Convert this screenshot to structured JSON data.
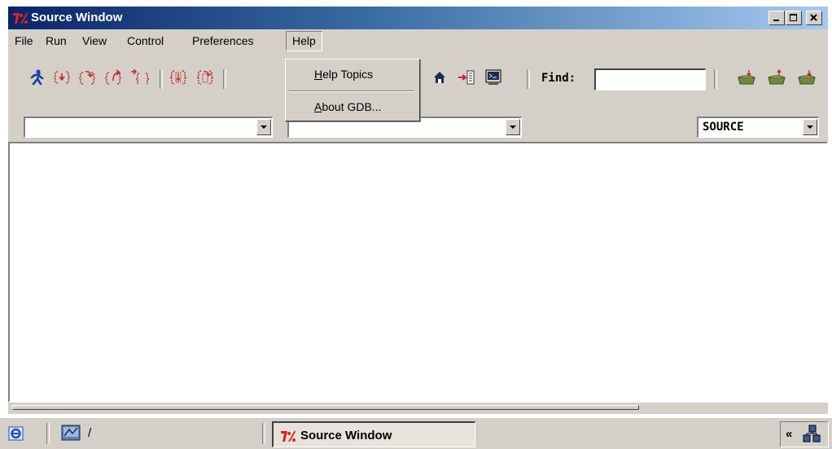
{
  "window": {
    "title": "Source Window",
    "minimize": "_",
    "maximize": "□",
    "close": "×"
  },
  "menubar": {
    "items": [
      "File",
      "Run",
      "View",
      "Control",
      "Preferences",
      "Help"
    ],
    "open_menu": "Help"
  },
  "help_menu": {
    "items": [
      {
        "mnemonic": "H",
        "rest": "elp Topics"
      },
      {
        "mnemonic": "A",
        "rest": "bout GDB..."
      }
    ]
  },
  "toolbar": {
    "find_label": "Find:",
    "find_value": "",
    "function_combo_value": "",
    "file_combo_value": "",
    "mode_combo_value": "SOURCE"
  },
  "taskbar": {
    "address_text": "/",
    "task_button_label": "Source Window",
    "tray_chevron": "«"
  },
  "colors": {
    "title_start": "#0a246a",
    "title_end": "#a6caf0",
    "face": "#d4d0c8",
    "icon_red": "#c0262c"
  }
}
